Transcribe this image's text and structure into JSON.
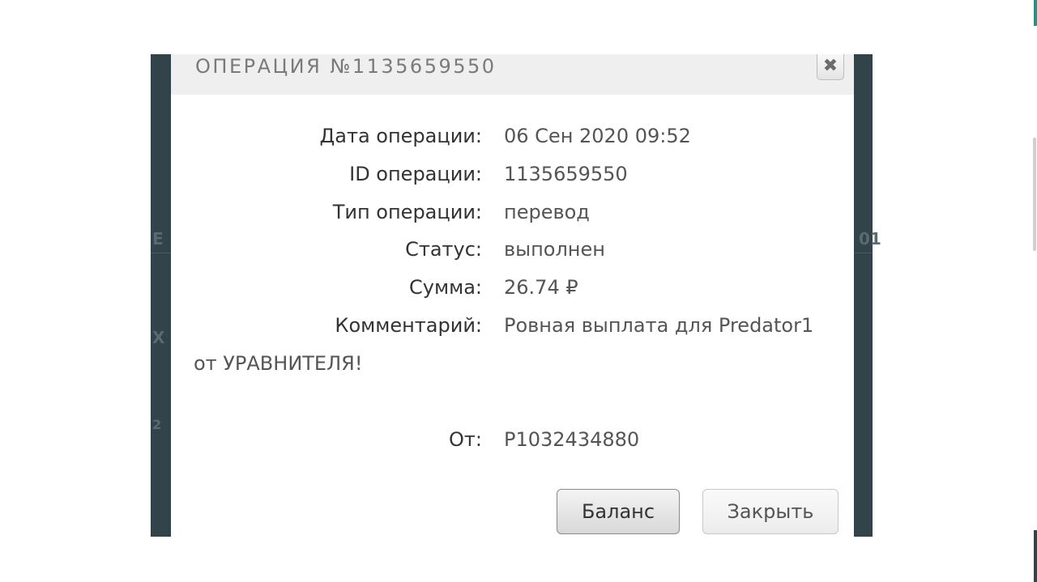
{
  "dialog": {
    "title": "ОПЕРАЦИЯ №1135659550",
    "close_icon": "close-icon",
    "close_glyph": "✖"
  },
  "details": [
    {
      "label": "Дата операции:",
      "value": "06 Сен 2020 09:52"
    },
    {
      "label": "ID операции:",
      "value": "1135659550"
    },
    {
      "label": "Тип операции:",
      "value": "перевод"
    },
    {
      "label": "Статус:",
      "value": "выполнен"
    },
    {
      "label": "Сумма:",
      "value": "26.74 ₽"
    },
    {
      "label": "Комментарий:",
      "value": "Ровная выплата для Predator1"
    }
  ],
  "comment_continuation": "от УРАВНИТЕЛЯ!",
  "from": {
    "label": "От:",
    "value": "P1032434880"
  },
  "buttons": {
    "balance": "Баланс",
    "close": "Закрыть"
  },
  "colors": {
    "backdrop": "#33434a",
    "header_bg": "#efefef",
    "accent": "#2f8f84"
  }
}
